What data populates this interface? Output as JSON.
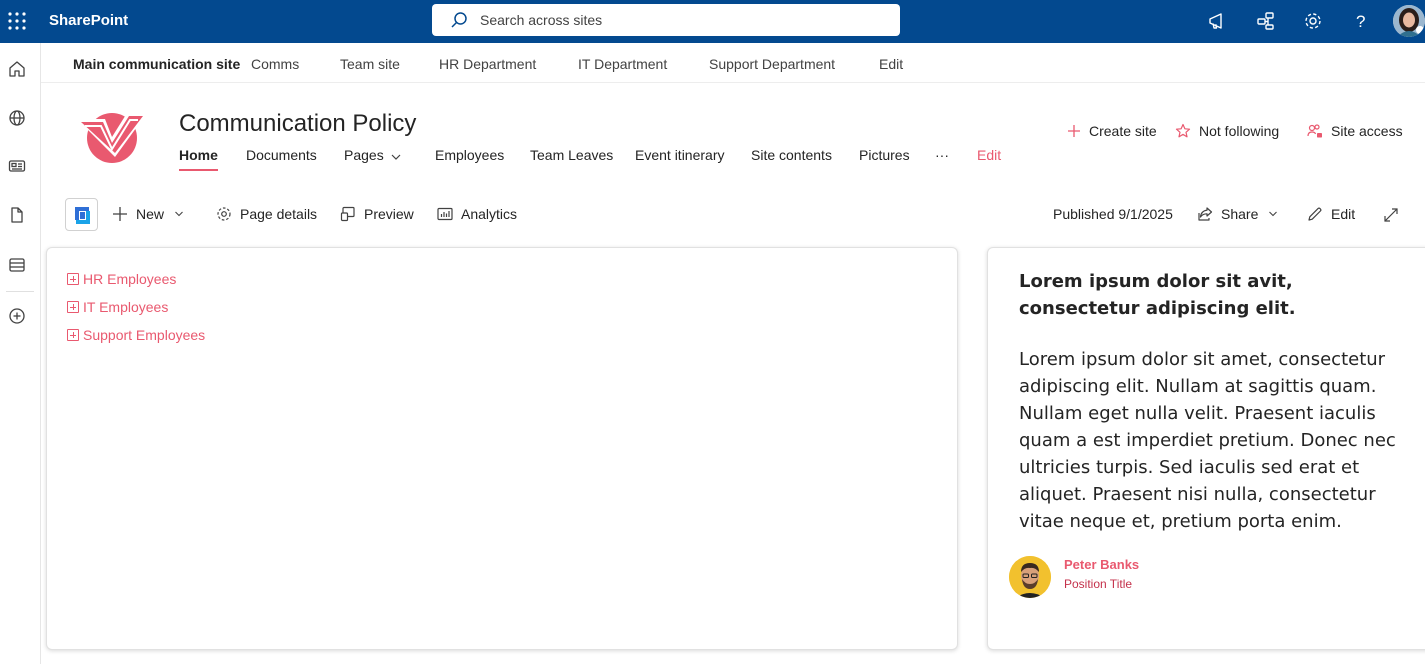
{
  "suitebar": {
    "brand": "SharePoint",
    "search_placeholder": "Search across sites",
    "bg_color": "#03498f"
  },
  "left_rail": {
    "icons": [
      "home-icon",
      "globe-icon",
      "news-icon",
      "document-icon",
      "list-icon",
      "add-icon"
    ]
  },
  "hub_nav": {
    "items": [
      "Main communication site",
      "Comms",
      "Team site",
      "HR Department",
      "IT Department",
      "Support Department",
      "Edit"
    ]
  },
  "site": {
    "title": "Communication Policy",
    "nav": [
      "Home",
      "Documents",
      "Pages",
      "Employees",
      "Team Leaves",
      "Event itinerary",
      "Site contents",
      "Pictures",
      "···",
      "Edit"
    ],
    "actions": {
      "create_site": "Create site",
      "following": "Not following",
      "site_access": "Site access"
    },
    "accent_color": "#e9596f"
  },
  "command_bar": {
    "new": "New",
    "page_details": "Page details",
    "preview": "Preview",
    "analytics": "Analytics",
    "published": "Published 9/1/2025",
    "share": "Share",
    "edit": "Edit"
  },
  "tree": {
    "items": [
      "HR Employees",
      "IT Employees",
      "Support Employees"
    ]
  },
  "quote_card": {
    "heading": "Lorem ipsum dolor sit avit, consectetur adipiscing elit.",
    "body": "Lorem ipsum dolor sit amet, consectetur adipiscing elit. Nullam at sagittis quam. Nullam eget nulla velit. Praesent iaculis quam a est imperdiet pretium. Donec nec ultricies turpis. Sed iaculis sed erat et aliquet. Praesent nisi nulla, consectetur vitae neque et, pretium porta enim.",
    "person_name": "Peter Banks",
    "person_title": "Position Title"
  }
}
